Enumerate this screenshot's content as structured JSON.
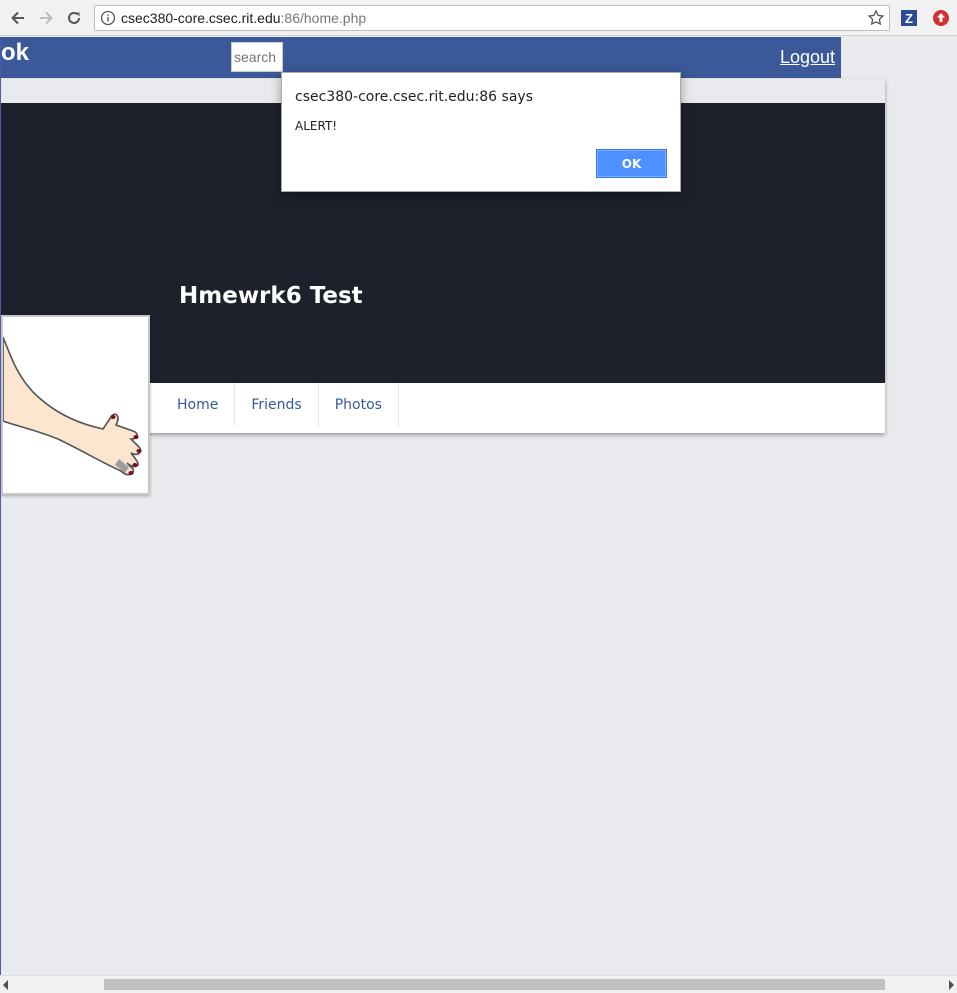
{
  "browser": {
    "url_host": "csec380-core.csec.rit.edu",
    "url_rest": ":86/home.php",
    "extension_label": "Z"
  },
  "site": {
    "logo_fragment": "ok",
    "search_placeholder": "search",
    "logout_label": "Logout"
  },
  "profile": {
    "name": "Hmewrk6 Test",
    "tabs": [
      {
        "label": "Home"
      },
      {
        "label": "Friends"
      },
      {
        "label": "Photos"
      }
    ]
  },
  "alert": {
    "title": "csec380-core.csec.rit.edu:86 says",
    "message": "ALERT!",
    "ok_label": "OK"
  },
  "colors": {
    "brand_blue": "#3b5998",
    "cover_dark": "#1c212b",
    "ok_button": "#4d90fe",
    "tab_link": "#365899"
  }
}
